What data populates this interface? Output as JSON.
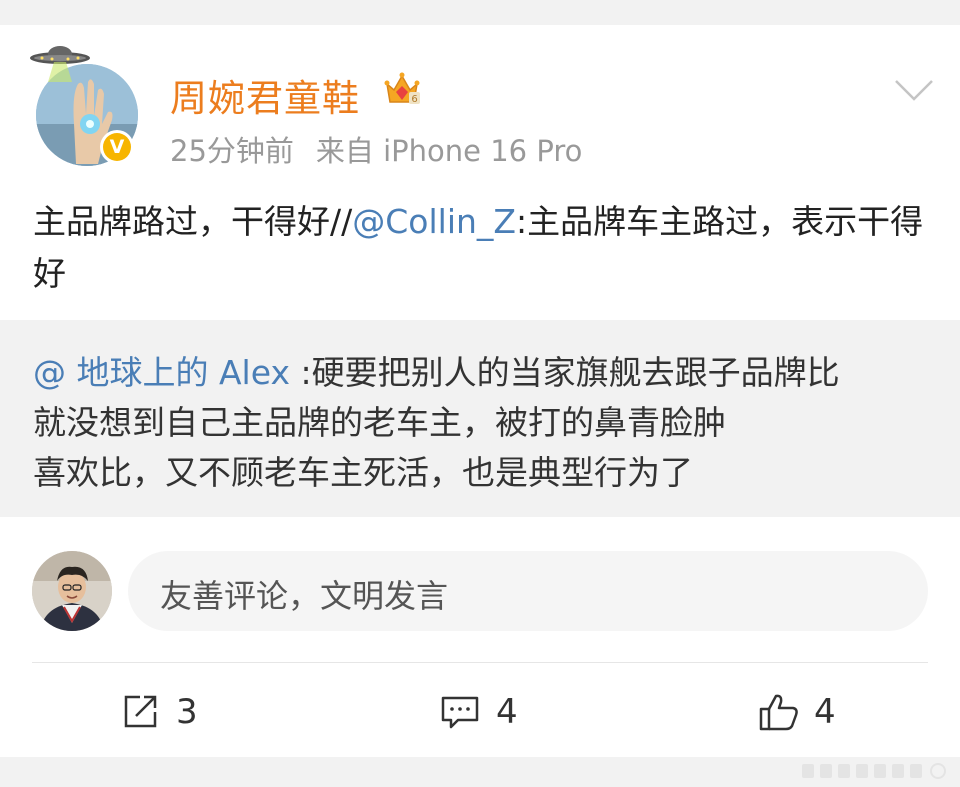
{
  "post": {
    "author": "周婉君童鞋",
    "time": "25分钟前",
    "source": "来自 iPhone 16 Pro",
    "text_part1": "主品牌路过，干得好//",
    "mention": "@Collin_Z",
    "text_part2": ":主品牌车主路过，表示干得好",
    "verified_badge": "V",
    "crown_level": "6"
  },
  "repost": {
    "mention": "@ 地球上的 Alex",
    "line1_text": " :硬要把别人的当家旗舰去跟子品牌比",
    "line2": "就没想到自己主品牌的老车主，被打的鼻青脸肿",
    "line3": "喜欢比，又不顾老车主死活，也是典型行为了"
  },
  "comment": {
    "placeholder": "友善评论，文明发言"
  },
  "actions": {
    "repost_count": "3",
    "comment_count": "4",
    "like_count": "4"
  },
  "colors": {
    "username": "#ec7d1e",
    "mention": "#4a7eb6",
    "badge": "#f7b500",
    "repost_bg": "#f2f2f2"
  },
  "icons": {
    "more": "chevron-down-icon",
    "repost": "share-icon",
    "comment": "comment-icon",
    "like": "thumb-up-icon"
  }
}
